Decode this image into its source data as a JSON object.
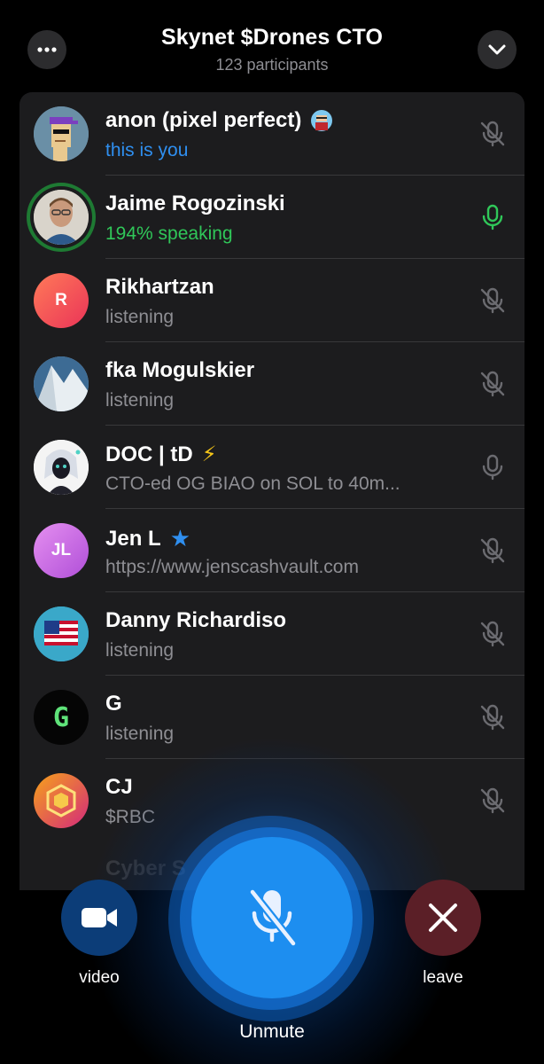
{
  "header": {
    "title": "Skynet $Drones CTO",
    "participants": "123 participants"
  },
  "participants": [
    {
      "name": "anon (pixel perfect)",
      "badge": "avatar-emoji",
      "status": "this is you",
      "status_type": "you",
      "mic": "muted"
    },
    {
      "name": "Jaime Rogozinski",
      "status": "194% speaking",
      "status_type": "speaking",
      "mic": "active"
    },
    {
      "name": "Rikhartzan",
      "initials": "R",
      "status": "listening",
      "status_type": "normal",
      "mic": "muted"
    },
    {
      "name": "fka Mogulskier",
      "status": "listening",
      "status_type": "normal",
      "mic": "muted"
    },
    {
      "name": "DOC | tD",
      "badge": "⚡",
      "status": "CTO-ed OG BIAO on SOL to 40m...",
      "status_type": "normal",
      "mic": "unmuted-idle"
    },
    {
      "name": "Jen L",
      "initials": "JL",
      "badge": "★",
      "status": "https://www.jenscashvault.com",
      "status_type": "normal",
      "mic": "muted"
    },
    {
      "name": "Danny Richardiso",
      "status": "listening",
      "status_type": "normal",
      "mic": "muted"
    },
    {
      "name": "G",
      "initials": "G",
      "status": "listening",
      "status_type": "normal",
      "mic": "muted"
    },
    {
      "name": "CJ",
      "status": "$RBC",
      "status_type": "normal",
      "mic": "muted"
    }
  ],
  "faded_next_name": "Cyber S",
  "controls": {
    "video_label": "video",
    "unmute_label": "Unmute",
    "leave_label": "leave"
  },
  "colors": {
    "accent_blue": "#1d8ef0",
    "speaking_green": "#30c759",
    "you_blue": "#2f8ff0",
    "leave_red": "#5b1f27",
    "video_blue": "#0c3d78"
  }
}
